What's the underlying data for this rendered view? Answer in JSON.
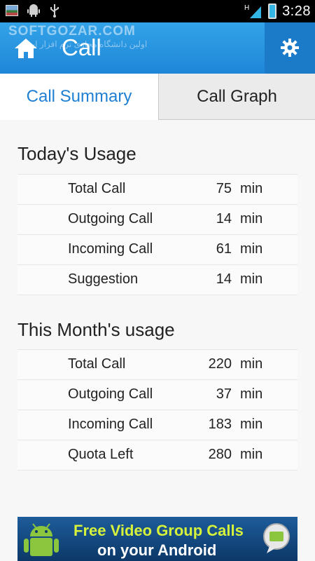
{
  "status_bar": {
    "time": "3:28",
    "network_label": "H",
    "icons": [
      "gallery-icon",
      "android-debug-icon",
      "usb-icon",
      "signal-icon",
      "battery-icon"
    ]
  },
  "action_bar": {
    "title": "Call",
    "watermark": "SOFTGOZAR.COM",
    "watermark_sub": "اولین دانشگاه مجازی نرم افزار ایران",
    "home_icon": "home-icon",
    "settings_icon": "gear-icon",
    "background_color": "#2a95e0"
  },
  "tabs": [
    {
      "label": "Call Summary",
      "active": true
    },
    {
      "label": "Call Graph",
      "active": false
    }
  ],
  "today": {
    "title": "Today's Usage",
    "rows": [
      {
        "label": "Total Call",
        "value": "75",
        "unit": "min"
      },
      {
        "label": "Outgoing Call",
        "value": "14",
        "unit": "min"
      },
      {
        "label": "Incoming Call",
        "value": "61",
        "unit": "min"
      },
      {
        "label": "Suggestion",
        "value": "14",
        "unit": "min"
      }
    ]
  },
  "month": {
    "title": "This Month's usage",
    "rows": [
      {
        "label": "Total Call",
        "value": "220",
        "unit": "min"
      },
      {
        "label": "Outgoing Call",
        "value": "37",
        "unit": "min"
      },
      {
        "label": "Incoming Call",
        "value": "183",
        "unit": "min"
      },
      {
        "label": "Quota Left",
        "value": "280",
        "unit": "min"
      }
    ]
  },
  "ad": {
    "line1": "Free Video Group Calls",
    "line2": "on your Android"
  },
  "colors": {
    "accent": "#1e7fd3",
    "ad_headline": "#d6f23b"
  }
}
